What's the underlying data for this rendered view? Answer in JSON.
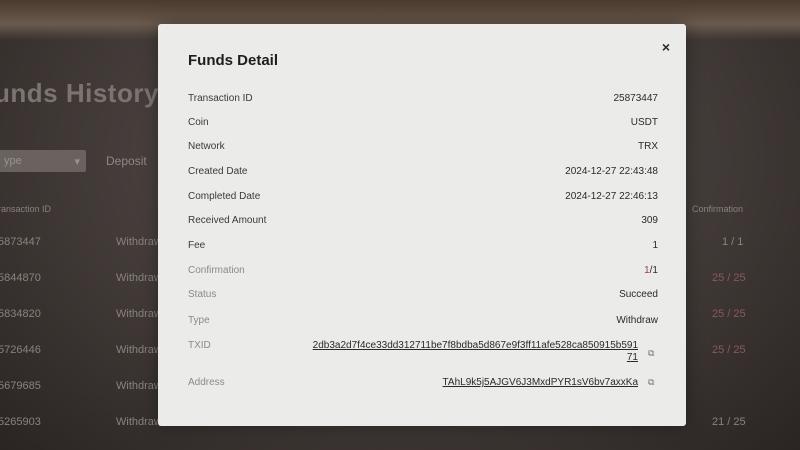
{
  "background": {
    "title": "unds History",
    "select_label": "ype",
    "tab_deposit": "Deposit",
    "header_txid": "ransaction ID",
    "header_confirmation": "Confirmation",
    "rows": [
      {
        "id": "5873447",
        "type": "Withdraw",
        "conf": "1 / 1",
        "red": false
      },
      {
        "id": "5844870",
        "type": "Withdraw",
        "conf": "25 / 25",
        "red": true
      },
      {
        "id": "5834820",
        "type": "Withdraw",
        "conf": "25 / 25",
        "red": true
      },
      {
        "id": "5726446",
        "type": "Withdraw",
        "conf": "25 / 25",
        "red": true
      },
      {
        "id": "5679685",
        "type": "Withdraw",
        "conf": "",
        "red": false
      },
      {
        "id": "5265903",
        "type": "Withdraw",
        "conf": "21 / 25",
        "red": false
      }
    ]
  },
  "modal": {
    "title": "Funds Detail",
    "close_icon": "×",
    "fields": {
      "transaction_id": {
        "label": "Transaction ID",
        "value": "25873447"
      },
      "coin": {
        "label": "Coin",
        "value": "USDT"
      },
      "network": {
        "label": "Network",
        "value": "TRX"
      },
      "created_date": {
        "label": "Created Date",
        "value": "2024-12-27 22:43:48"
      },
      "completed_date": {
        "label": "Completed Date",
        "value": "2024-12-27 22:46:13"
      },
      "received_amount": {
        "label": "Received Amount",
        "value": "309"
      },
      "fee": {
        "label": "Fee",
        "value": "1"
      },
      "confirmation": {
        "label": "Confirmation",
        "value_red": "1",
        "value_rest": "/1"
      },
      "status": {
        "label": "Status",
        "value": "Succeed"
      },
      "type": {
        "label": "Type",
        "value": "Withdraw"
      },
      "txid": {
        "label": "TXID",
        "value": "2db3a2d7f4ce33dd312711be7f8bdba5d867e9f3ff11afe528ca850915b59171"
      },
      "address": {
        "label": "Address",
        "value": "TAhL9k5j5AJGV6J3MxdPYR1sV6bv7axxKa"
      }
    }
  }
}
